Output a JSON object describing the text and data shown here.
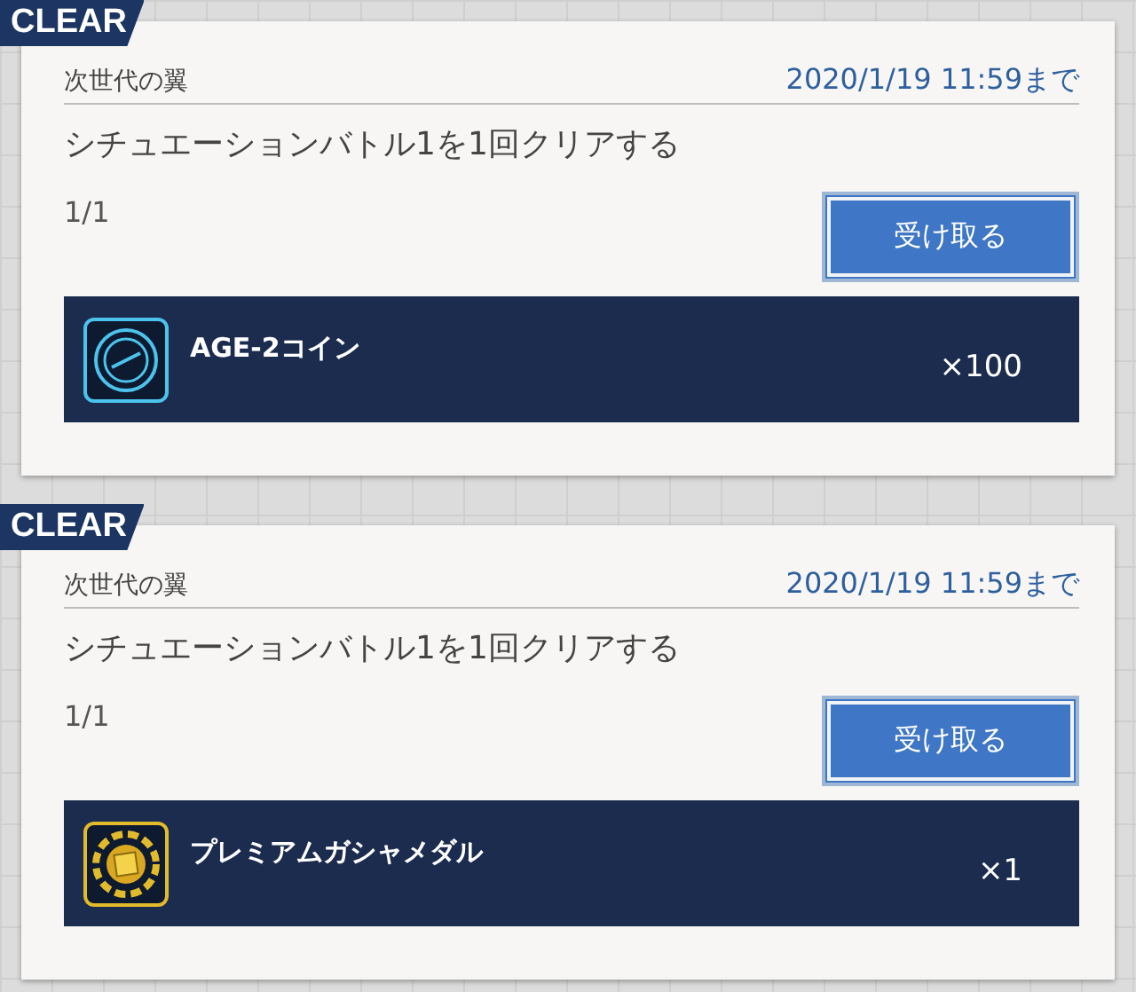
{
  "missions": [
    {
      "badge": "CLEAR",
      "title": "次世代の翼",
      "deadline": "2020/1/19 11:59まで",
      "description": "シチュエーションバトル1を1回クリアする",
      "progress": "1/1",
      "button": "受け取る",
      "reward": {
        "kind": "coin",
        "name": "AGE-2コイン",
        "quantity": "×100"
      }
    },
    {
      "badge": "CLEAR",
      "title": "次世代の翼",
      "deadline": "2020/1/19 11:59まで",
      "description": "シチュエーションバトル1を1回クリアする",
      "progress": "1/1",
      "button": "受け取る",
      "reward": {
        "kind": "medal",
        "name": "プレミアムガシャメダル",
        "quantity": "×1"
      }
    }
  ]
}
